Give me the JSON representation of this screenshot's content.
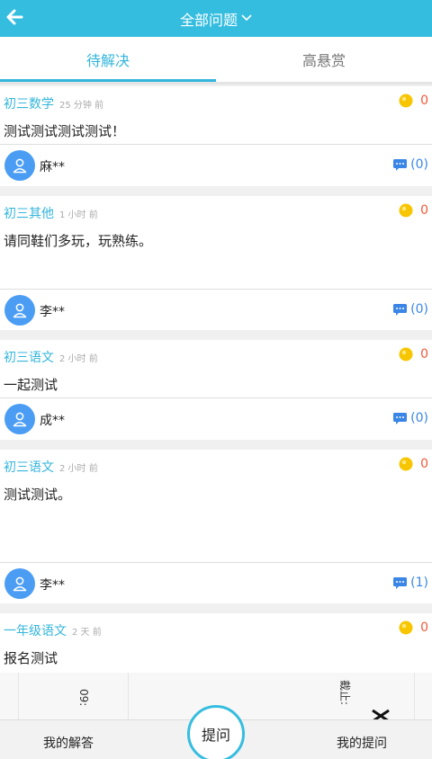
{
  "header": {
    "title": "全部问题",
    "back_icon": "back-arrow-icon",
    "dropdown_icon": "chevron-down-icon",
    "bg_color": "#35bde0"
  },
  "tabs": [
    {
      "label": "待解决",
      "active": true
    },
    {
      "label": "高悬赏",
      "active": false
    }
  ],
  "questions": [
    {
      "subject": "初三数学",
      "time": "25 分钟 前",
      "reward": "0",
      "content": "测试测试测试测试！",
      "user": "麻**",
      "comments": "(0)"
    },
    {
      "subject": "初三其他",
      "time": "1 小时 前",
      "reward": "0",
      "content": "请同鞋们多玩，玩熟练。",
      "user": "李**",
      "comments": "(0)"
    },
    {
      "subject": "初三语文",
      "time": "2 小时 前",
      "reward": "0",
      "content": "一起测试",
      "user": "成**",
      "comments": "(0)"
    },
    {
      "subject": "初三语文",
      "time": "2 小时 前",
      "reward": "0",
      "content": "测试测试。",
      "user": "李**",
      "comments": "(1)"
    },
    {
      "subject": "一年级语文",
      "time": "2 天 前",
      "reward": "0",
      "content": "报名测试"
    }
  ],
  "partial_image_text": {
    "left": "09:",
    "right": "截止:"
  },
  "bottom_nav": {
    "left": "我的解答",
    "center": "提问",
    "right": "我的提问"
  }
}
